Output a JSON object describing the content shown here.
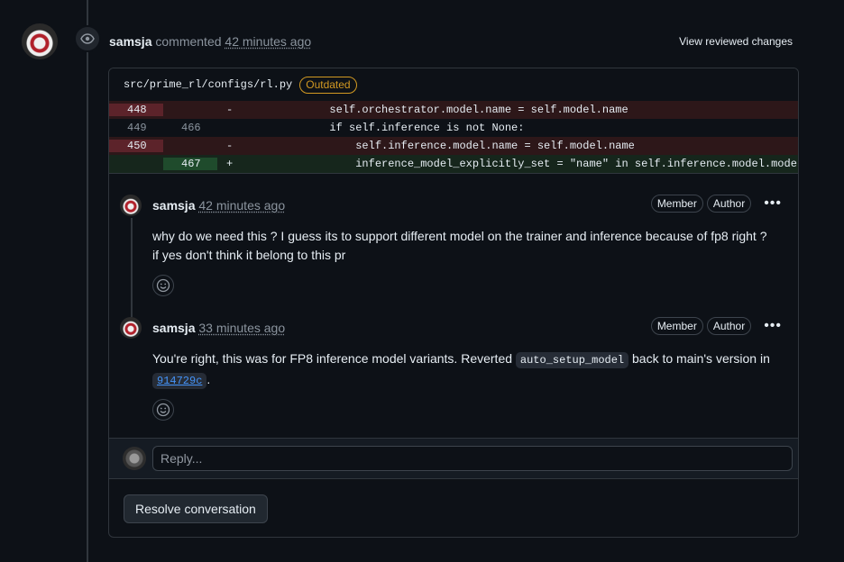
{
  "event": {
    "author": "samsja",
    "action": "commented",
    "time": "42 minutes ago",
    "view_changes_label": "View reviewed changes"
  },
  "file": {
    "path": "src/prime_rl/configs/rl.py",
    "status_label": "Outdated"
  },
  "diff": [
    {
      "type": "del",
      "old": "448",
      "new": "",
      "marker": "-",
      "code": "            self.orchestrator.model.name = self.model.name"
    },
    {
      "type": "ctx",
      "old": "449",
      "new": "466",
      "marker": "",
      "code": "            if self.inference is not None:"
    },
    {
      "type": "del",
      "old": "450",
      "new": "",
      "marker": "-",
      "code": "                self.inference.model.name = self.model.name"
    },
    {
      "type": "add",
      "old": "",
      "new": "467",
      "marker": "+",
      "code": "                inference_model_explicitly_set = \"name\" in self.inference.model.model_fields_set"
    }
  ],
  "comments": [
    {
      "author": "samsja",
      "time": "42 minutes ago",
      "badges": [
        "Member",
        "Author"
      ],
      "body": "why do we need this ? I guess its to support different model on the trainer and inference because of fp8 right ? if yes don't think it belong to this pr"
    },
    {
      "author": "samsja",
      "time": "33 minutes ago",
      "badges": [
        "Member",
        "Author"
      ],
      "body_parts": {
        "pre": "You're right, this was for FP8 inference model variants. Reverted ",
        "code": "auto_setup_model",
        "mid": " back to main's version in ",
        "commit": "914729c",
        "post": "."
      }
    }
  ],
  "reply": {
    "placeholder": "Reply..."
  },
  "resolve_label": "Resolve conversation",
  "icons": {
    "event": "eye-icon",
    "reaction": "smiley-icon",
    "menu": "kebab-horizontal-icon"
  },
  "colors": {
    "background": "#0d1117",
    "deleted_line": "#2d1719",
    "added_line": "#16261c",
    "outdated": "#d29922",
    "link": "#4493f8"
  }
}
